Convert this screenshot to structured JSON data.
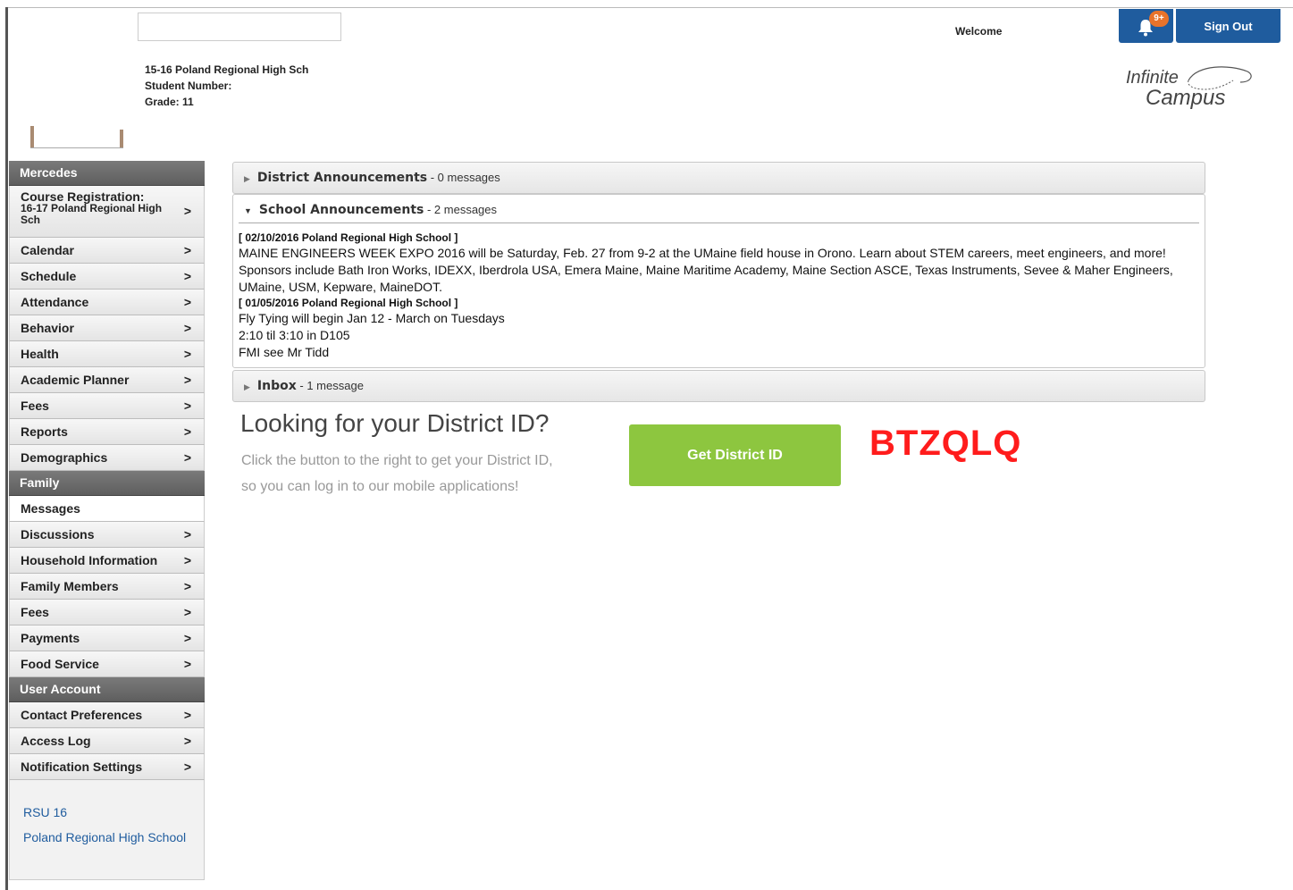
{
  "header": {
    "school_name": "15-16 Poland Regional High Sch",
    "student_number_label": "Student Number:",
    "grade_label": "Grade: 11",
    "welcome": "Welcome",
    "notification_badge": "9+",
    "sign_out": "Sign Out",
    "logo_line1": "Infinite",
    "logo_line2": "Campus"
  },
  "sidebar": {
    "student_section": "Mercedes",
    "course_registration_title": "Course Registration:",
    "course_registration_sub": "16-17 Poland Regional High Sch",
    "student_items": [
      "Calendar",
      "Schedule",
      "Attendance",
      "Behavior",
      "Health",
      "Academic Planner",
      "Fees",
      "Reports",
      "Demographics"
    ],
    "family_section": "Family",
    "active_item": "Messages",
    "family_items": [
      "Discussions",
      "Household Information",
      "Family Members",
      "Fees",
      "Payments",
      "Food Service"
    ],
    "account_section": "User Account",
    "account_items": [
      "Contact Preferences",
      "Access Log",
      "Notification Settings"
    ],
    "footer_links": [
      "RSU 16",
      "Poland Regional High School"
    ],
    "chevron": ">"
  },
  "panels": {
    "district": {
      "title": "District Announcements",
      "count": " - 0 messages"
    },
    "school": {
      "title": "School Announcements",
      "count": " - 2 messages",
      "messages": [
        {
          "header": "[ 02/10/2016 Poland Regional High School ]",
          "lines": [
            "MAINE ENGINEERS WEEK EXPO 2016 will be Saturday, Feb. 27 from 9-2 at the UMaine field house in Orono. Learn about STEM careers, meet engineers, and more! Sponsors include Bath Iron Works, IDEXX, Iberdrola USA, Emera Maine, Maine Maritime Academy, Maine Section ASCE, Texas Instruments, Sevee & Maher Engineers, UMaine, USM, Kepware, MaineDOT."
          ]
        },
        {
          "header": "[ 01/05/2016 Poland Regional High School ]",
          "lines": [
            "Fly Tying will begin Jan 12 - March on Tuesdays",
            "2:10 til 3:10 in D105",
            "FMI see Mr Tidd"
          ]
        }
      ]
    },
    "inbox": {
      "title": "Inbox",
      "count": " - 1 message"
    }
  },
  "district_id": {
    "title": "Looking for your District ID?",
    "line1": "Click the button to the right to get your District ID,",
    "line2": "so you can log in to our mobile applications!",
    "button": "Get District ID",
    "code": "BTZQLQ"
  },
  "colors": {
    "brand_blue": "#1f5c9e",
    "badge_orange": "#e8732b",
    "button_green": "#8dc63f",
    "code_red": "#ff1c1c"
  }
}
